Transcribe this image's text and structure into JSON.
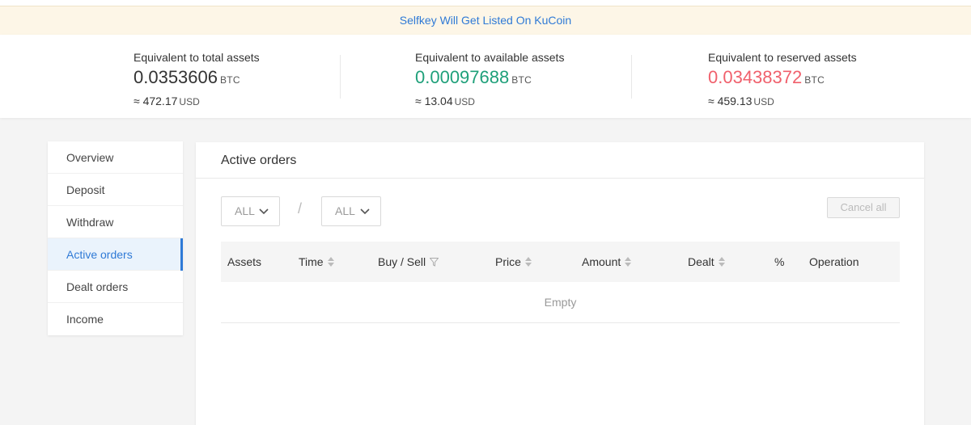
{
  "notice": {
    "text": "Selfkey Will Get Listed On KuCoin"
  },
  "summary": {
    "total": {
      "label": "Equivalent to total assets",
      "btc": "0.0353606",
      "btc_unit": "BTC",
      "usd": "≈ 472.17",
      "usd_unit": "USD",
      "color": "#333333"
    },
    "available": {
      "label": "Equivalent to available assets",
      "btc": "0.00097688",
      "btc_unit": "BTC",
      "usd": "≈ 13.04",
      "usd_unit": "USD",
      "color": "#1fa07a"
    },
    "reserved": {
      "label": "Equivalent to reserved assets",
      "btc": "0.03438372",
      "btc_unit": "BTC",
      "usd": "≈ 459.13",
      "usd_unit": "USD",
      "color": "#f0606c"
    }
  },
  "sidebar": {
    "items": [
      {
        "label": "Overview"
      },
      {
        "label": "Deposit"
      },
      {
        "label": "Withdraw"
      },
      {
        "label": "Active orders"
      },
      {
        "label": "Dealt orders"
      },
      {
        "label": "Income"
      }
    ],
    "active_index": 3
  },
  "panel": {
    "title": "Active orders",
    "filter_left": {
      "value": "ALL",
      "icon": "chevron-down-icon"
    },
    "separator": "/",
    "filter_right": {
      "value": "ALL",
      "icon": "chevron-down-icon"
    },
    "cancel_all_label": "Cancel all",
    "columns": [
      {
        "label": "Assets"
      },
      {
        "label": "Time",
        "icon": "sort-icon"
      },
      {
        "label": "Buy / Sell",
        "icon": "filter-icon"
      },
      {
        "label": "Price",
        "icon": "sort-icon"
      },
      {
        "label": "Amount",
        "icon": "sort-icon"
      },
      {
        "label": "Dealt",
        "icon": "sort-icon"
      },
      {
        "label": "%"
      },
      {
        "label": "Operation"
      }
    ],
    "empty_text": "Empty"
  },
  "colors": {
    "accent": "#2f7ad6",
    "notice_bg": "#fdf6e7",
    "positive": "#1fa07a",
    "negative": "#f0606c"
  }
}
